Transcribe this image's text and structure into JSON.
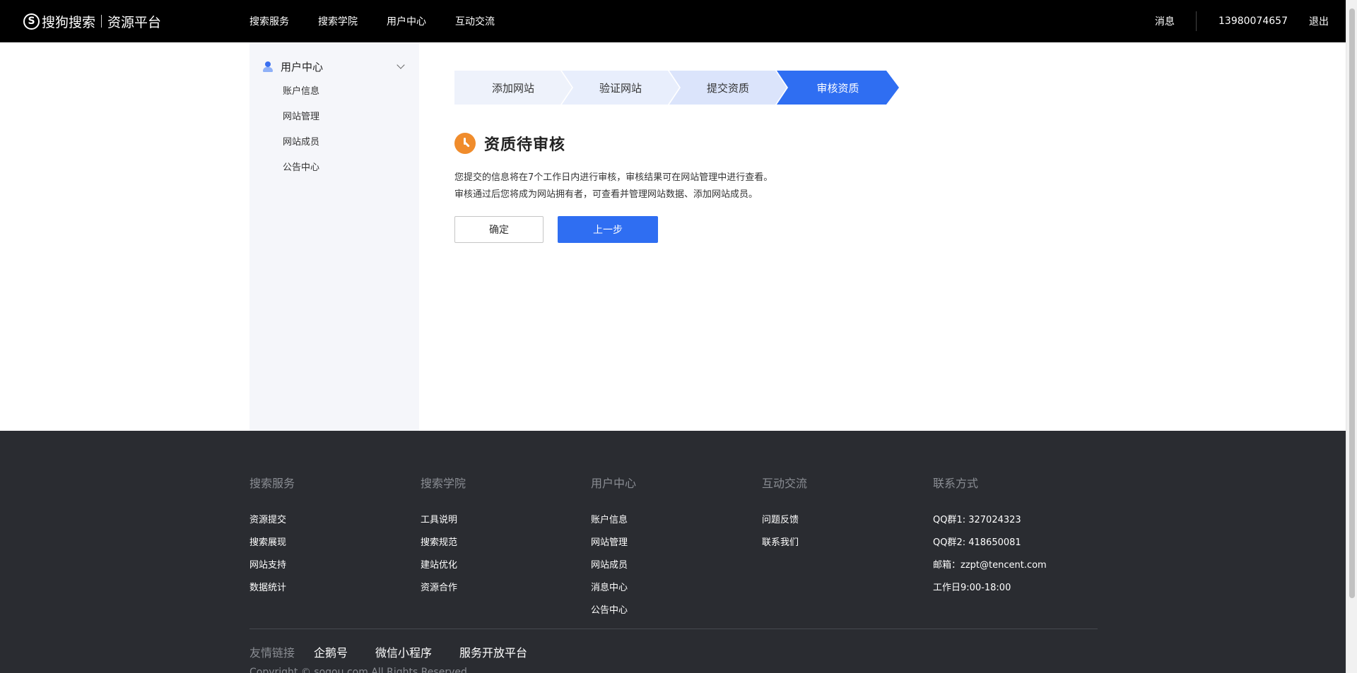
{
  "header": {
    "logo_brand": "搜狗搜索",
    "logo_mark": "S",
    "logo_product": "资源平台",
    "nav": [
      "搜索服务",
      "搜索学院",
      "用户中心",
      "互动交流"
    ],
    "messages_label": "消息",
    "phone": "13980074657",
    "logout_label": "退出"
  },
  "sidebar": {
    "title": "用户中心",
    "items": [
      "账户信息",
      "网站管理",
      "网站成员",
      "公告中心"
    ]
  },
  "steps": [
    "添加网站",
    "验证网站",
    "提交资质",
    "审核资质"
  ],
  "active_step": 4,
  "status": {
    "title": "资质待审核",
    "line1": "您提交的信息将在7个工作日内进行审核，审核结果可在网站管理中进行查看。",
    "line2": "审核通过后您将成为网站拥有者，可查看并管理网站数据、添加网站成员。"
  },
  "buttons": {
    "confirm": "确定",
    "prev": "上一步"
  },
  "footer": {
    "columns": [
      {
        "title": "搜索服务",
        "links": [
          "资源提交",
          "搜索展现",
          "网站支持",
          "数据统计"
        ]
      },
      {
        "title": "搜索学院",
        "links": [
          "工具说明",
          "搜索规范",
          "建站优化",
          "资源合作"
        ]
      },
      {
        "title": "用户中心",
        "links": [
          "账户信息",
          "网站管理",
          "网站成员",
          "消息中心",
          "公告中心"
        ]
      },
      {
        "title": "互动交流",
        "links": [
          "问题反馈",
          "联系我们"
        ]
      }
    ],
    "contact": {
      "title": "联系方式",
      "lines": [
        "QQ群1: 327024323",
        "QQ群2: 418650081",
        "邮箱：zzpt@tencent.com",
        "工作日9:00-18:00"
      ]
    },
    "friends_label": "友情链接",
    "friends": [
      "企鹅号",
      "微信小程序",
      "服务开放平台"
    ],
    "copyright": "Copyright © sogou.com All Rights Reserved"
  },
  "colors": {
    "header_bg": "#000000",
    "accent": "#2f6ef2",
    "status_icon": "#f08c2c",
    "footer_bg": "#2a2c31",
    "sidebar_bg": "#f5f6fa"
  },
  "icons": [
    "sogou-logo-icon",
    "user-icon",
    "chevron-down-icon",
    "clock-icon"
  ]
}
